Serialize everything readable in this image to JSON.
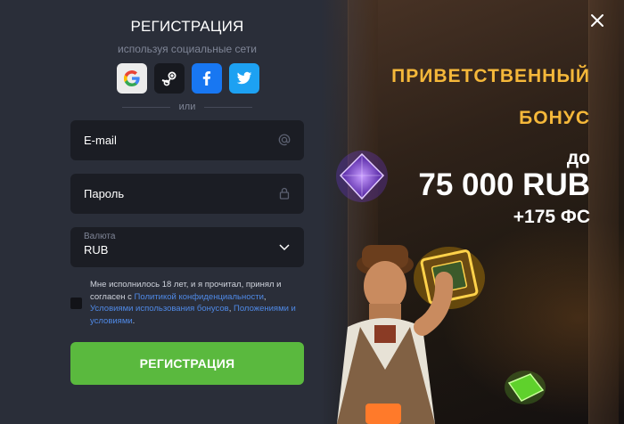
{
  "form": {
    "title": "РЕГИСТРАЦИЯ",
    "subtitle": "используя социальные сети",
    "social": [
      {
        "name": "google",
        "icon": "google-icon"
      },
      {
        "name": "steam",
        "icon": "steam-icon"
      },
      {
        "name": "facebook",
        "icon": "facebook-icon"
      },
      {
        "name": "twitter",
        "icon": "twitter-icon"
      }
    ],
    "or_label": "или",
    "email_placeholder": "E-mail",
    "password_placeholder": "Пароль",
    "currency": {
      "caption": "Валюта",
      "value": "RUB"
    },
    "consent": {
      "text_before": "Мне исполнилось 18 лет, и я прочитал, принял и согласен с ",
      "link_privacy": "Политикой конфиденциальности",
      "sep1": ", ",
      "link_bonus_terms": "Условиями использования бонусов",
      "sep2": ", ",
      "link_terms": "Положениями и условиями",
      "text_after": "."
    },
    "submit_label": "РЕГИСТРАЦИЯ"
  },
  "promo": {
    "line1": "ПРИВЕТСТВЕННЫЙ",
    "line2": "БОНУС",
    "line3": "до",
    "line4": "75 000 RUB",
    "line5": "+175 ФС"
  },
  "colors": {
    "panel_bg": "#2a2e39",
    "input_bg": "#1b1d24",
    "accent_gold": "#f5b83a",
    "submit_green": "#5ab93e",
    "link_blue": "#4f89e6"
  }
}
